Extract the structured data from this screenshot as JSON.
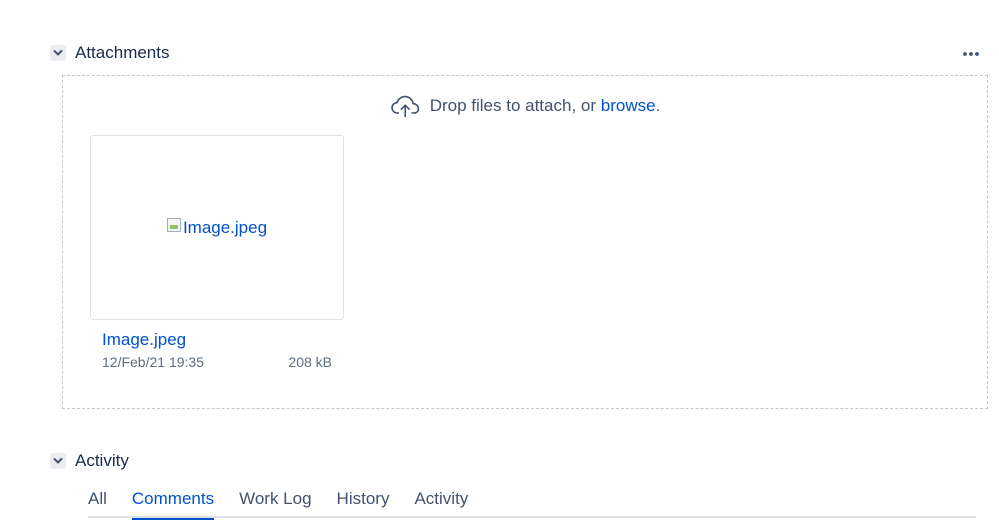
{
  "attachments": {
    "title": "Attachments",
    "toggle_icon": "chevron-down-icon",
    "more_icon": "more-horizontal-icon",
    "dropzone": {
      "icon": "cloud-upload-icon",
      "prompt": "Drop files to attach, or",
      "browse_label": "browse",
      "trailing": "."
    },
    "files": [
      {
        "thumbnail_alt": "Image.jpeg",
        "name": "Image.jpeg",
        "date": "12/Feb/21 19:35",
        "size": "208 kB"
      }
    ]
  },
  "activity": {
    "title": "Activity",
    "toggle_icon": "chevron-down-icon",
    "tabs": [
      {
        "label": "All",
        "active": false
      },
      {
        "label": "Comments",
        "active": true
      },
      {
        "label": "Work Log",
        "active": false
      },
      {
        "label": "History",
        "active": false
      },
      {
        "label": "Activity",
        "active": false
      }
    ]
  },
  "colors": {
    "link": "#0052cc",
    "text": "#172b4d",
    "muted": "#5e6c84",
    "border": "#dfe1e6"
  }
}
